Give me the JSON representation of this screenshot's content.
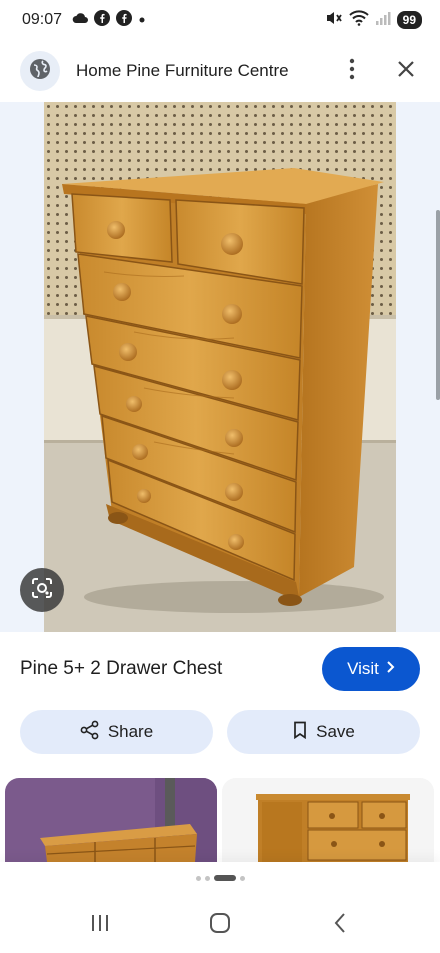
{
  "status_bar": {
    "time": "09:07",
    "battery": "99",
    "icons": [
      "cloud-icon",
      "facebook-icon",
      "facebook-icon",
      "dot-icon",
      "mute-icon",
      "wifi-icon",
      "signal-icon"
    ]
  },
  "header": {
    "site_name": "Home Pine Furniture Centre",
    "icons": [
      "globe-icon",
      "more-vert-icon",
      "close-icon"
    ]
  },
  "product": {
    "title": "Pine 5+ 2 Drawer Chest",
    "visit_label": "Visit",
    "share_label": "Share",
    "save_label": "Save"
  },
  "related": {
    "count_shown": 2
  },
  "carousel": {
    "dots": 4,
    "active_index": 2
  },
  "colors": {
    "accent": "#0b57d0",
    "chip_bg": "#e3ebfa",
    "image_bg": "#eef3fb",
    "pine": "#d79a3a"
  }
}
